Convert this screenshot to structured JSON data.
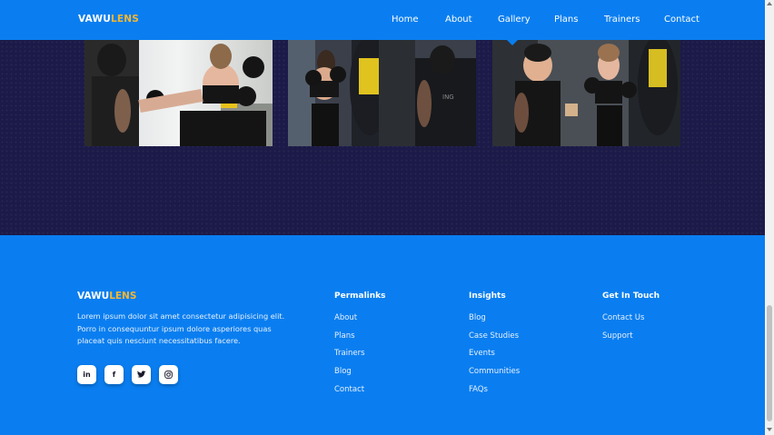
{
  "brand": {
    "part1": "VAWU",
    "part2": "LENS"
  },
  "nav": {
    "items": [
      {
        "label": "Home"
      },
      {
        "label": "About"
      },
      {
        "label": "Gallery"
      },
      {
        "label": "Plans"
      },
      {
        "label": "Trainers"
      },
      {
        "label": "Contact"
      }
    ],
    "active": "Gallery"
  },
  "gallery": {
    "images": [
      "kickboxing-kick-photo",
      "punching-bag-training-photo",
      "coach-pad-work-photo"
    ]
  },
  "footer": {
    "brand": {
      "part1": "VAWU",
      "part2": "LENS"
    },
    "description": "Lorem ipsum dolor sit amet consectetur adipisicing elit. Porro in consequuntur ipsum dolore asperiores quas placeat quis nesciunt necessitatibus facere.",
    "socials": [
      {
        "icon": "linkedin-icon",
        "glyph": "in"
      },
      {
        "icon": "facebook-icon",
        "glyph": "f"
      },
      {
        "icon": "twitter-icon",
        "glyph": "🐦"
      },
      {
        "icon": "instagram-icon",
        "glyph": "◎"
      }
    ],
    "columns": [
      {
        "title": "Permalinks",
        "links": [
          "About",
          "Plans",
          "Trainers",
          "Blog",
          "Contact"
        ]
      },
      {
        "title": "Insights",
        "links": [
          "Blog",
          "Case Studies",
          "Events",
          "Communities",
          "FAQs"
        ]
      },
      {
        "title": "Get In Touch",
        "links": [
          "Contact Us",
          "Support"
        ]
      }
    ]
  },
  "colors": {
    "primary": "#0a7ef0",
    "accent": "#f5b731",
    "dark": "#1c1a48"
  }
}
